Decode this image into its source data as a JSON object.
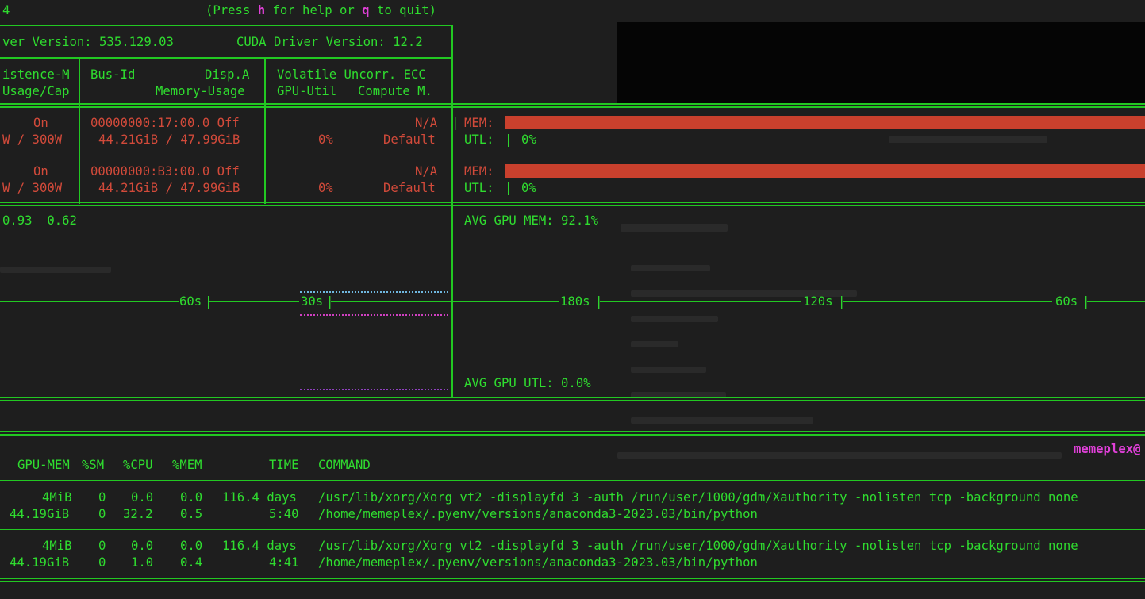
{
  "header": {
    "title_fragment": "4",
    "help_prefix": "(Press ",
    "help_key": "h",
    "help_mid": " for help or ",
    "quit_key": "q",
    "help_suffix": " to quit)"
  },
  "driver": {
    "driver_version": "ver Version: 535.129.03",
    "cuda_version": "CUDA Driver Version: 12.2"
  },
  "columns": {
    "c1_line1": "istence-M",
    "c1_line2": "Usage/Cap",
    "c2_line1_a": "Bus-Id",
    "c2_line1_b": "Disp.A",
    "c2_line2": "Memory-Usage",
    "c3_line1": "Volatile Uncorr. ECC",
    "c3_line2_a": "GPU-Util",
    "c3_line2_b": "Compute M."
  },
  "gpus": [
    {
      "persistence": "On",
      "power": "W / 300W",
      "bus_id": "00000000:17:00.0 Off",
      "memory": "44.21GiB / 47.99GiB",
      "ecc": "N/A",
      "util": "0%",
      "compute_mode": "Default",
      "mem_label": "MEM:",
      "utl_label": "UTL:",
      "utl_value": "0%",
      "mem_fraction": 0.921
    },
    {
      "persistence": "On",
      "power": "W / 300W",
      "bus_id": "00000000:B3:00.0 Off",
      "memory": "44.21GiB / 47.99GiB",
      "ecc": "N/A",
      "util": "0%",
      "compute_mode": "Default",
      "mem_label": "MEM:",
      "utl_label": "UTL:",
      "utl_value": "0%",
      "mem_fraction": 0.921
    }
  ],
  "load": {
    "values": "0.93  0.62"
  },
  "graphs": {
    "left_ticks": [
      "60s",
      "30s"
    ],
    "right_ticks": [
      "180s",
      "120s",
      "60s"
    ],
    "avg_mem": "AVG GPU MEM: 92.1%",
    "avg_utl": "AVG GPU UTL: 0.0%"
  },
  "processes": {
    "host": "memeplex@",
    "header": {
      "gpu_mem": "GPU-MEM",
      "sm": "%SM",
      "cpu": "%CPU",
      "mem": "%MEM",
      "time": "TIME",
      "command": "COMMAND"
    },
    "rows": [
      {
        "gpu_mem": "4MiB",
        "sm": "0",
        "cpu": "0.0",
        "mem": "0.0",
        "time": "116.4 days",
        "command": "/usr/lib/xorg/Xorg vt2 -displayfd 3 -auth /run/user/1000/gdm/Xauthority -nolisten tcp -background none"
      },
      {
        "gpu_mem": "44.19GiB",
        "sm": "0",
        "cpu": "32.2",
        "mem": "0.5",
        "time": "5:40",
        "command": "/home/memeplex/.pyenv/versions/anaconda3-2023.03/bin/python"
      },
      {
        "gpu_mem": "4MiB",
        "sm": "0",
        "cpu": "0.0",
        "mem": "0.0",
        "time": "116.4 days",
        "command": "/usr/lib/xorg/Xorg vt2 -displayfd 3 -auth /run/user/1000/gdm/Xauthority -nolisten tcp -background none"
      },
      {
        "gpu_mem": "44.19GiB",
        "sm": "0",
        "cpu": "1.0",
        "mem": "0.4",
        "time": "4:41",
        "command": "/home/memeplex/.pyenv/versions/anaconda3-2023.03/bin/python"
      }
    ]
  },
  "colors": {
    "terminal_green": "#2fdc2f",
    "border_green": "#22c822",
    "gpu_red": "#d24a3a",
    "bar_red": "#c9402d",
    "accent_magenta": "#e040d8"
  }
}
